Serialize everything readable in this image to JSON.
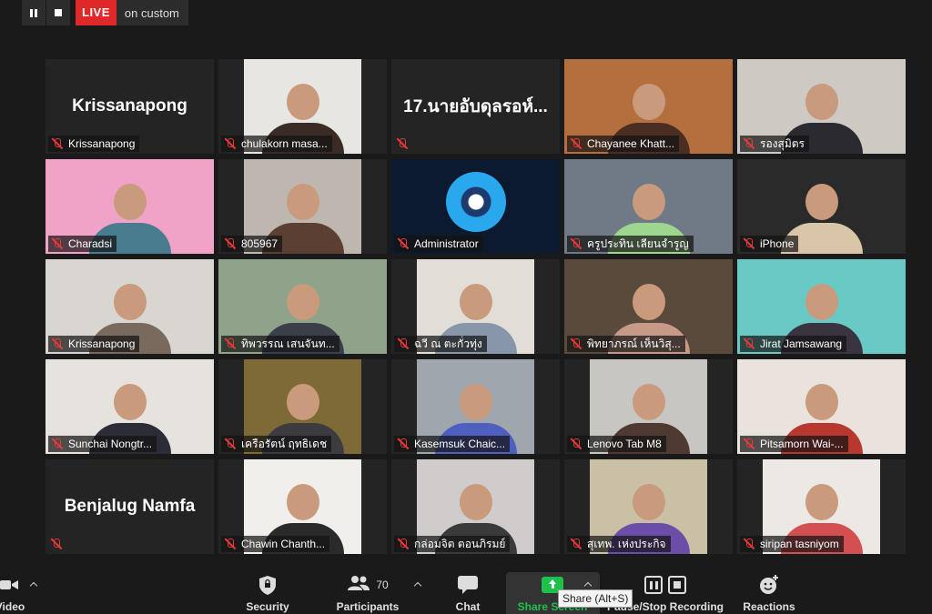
{
  "topbar": {
    "live_label": "LIVE",
    "live_status": "on custom"
  },
  "tiles": [
    {
      "name": "Krissanapong",
      "big_name": "Krissanapong",
      "kind": "text"
    },
    {
      "name": "chulakorn masa...",
      "kind": "video",
      "bg": "#e8e6e2",
      "subject": "#3a2c24"
    },
    {
      "name": "",
      "big_name": "17.นายอับดุลรอห์...",
      "kind": "text"
    },
    {
      "name": "Chayanee Khatt...",
      "kind": "video",
      "bg": "#b56f3f",
      "subject": "#4b2e22"
    },
    {
      "name": "รองสุมิตร",
      "kind": "video",
      "bg": "#cfc9c3",
      "subject": "#2a2a30"
    },
    {
      "name": "Charadsi",
      "kind": "video",
      "bg": "#f0a3c6",
      "subject": "#4a7c8f"
    },
    {
      "name": "805967",
      "kind": "video",
      "bg": "#bdb7b0",
      "subject": "#5c3f33"
    },
    {
      "name": "Administrator",
      "kind": "video",
      "bg": "#0b1a2e",
      "subject": "#1c8fd4"
    },
    {
      "name": "ครูประทิน  เลียนจำรูญ",
      "kind": "video",
      "bg": "#6f7a86",
      "subject": "#9fd68f",
      "active": true
    },
    {
      "name": "iPhone",
      "kind": "video",
      "bg": "#2a2a2a",
      "subject": "#d9c6a8"
    },
    {
      "name": "Krissanapong",
      "kind": "video",
      "bg": "#d9d6d2",
      "subject": "#7a6a5e"
    },
    {
      "name": "ทิพวรรณ เสนจันท...",
      "kind": "video",
      "bg": "#8fa38a",
      "subject": "#3a3f4a"
    },
    {
      "name": "ฉวี ณ ตะกั่วทุ่ง",
      "kind": "video",
      "bg": "#e2ddd7",
      "subject": "#8796a8"
    },
    {
      "name": "พิทยาภรณ์ เห็นวิสุ...",
      "kind": "video",
      "bg": "#5a4a3c",
      "subject": "#c79a88"
    },
    {
      "name": "Jirat Jamsawang",
      "kind": "video",
      "bg": "#69c9c4",
      "subject": "#3a3440"
    },
    {
      "name": "Sunchai Nongtr...",
      "kind": "video",
      "bg": "#e6e3df",
      "subject": "#2c2c36"
    },
    {
      "name": "เครือรัตน์  ฤทธิเดช",
      "kind": "video",
      "bg": "#7d6a36",
      "subject": "#3c3c40"
    },
    {
      "name": "Kasemsuk Chaic...",
      "kind": "video",
      "bg": "#9fa6ad",
      "subject": "#4f5fc0"
    },
    {
      "name": "Lenovo Tab M8",
      "kind": "video",
      "bg": "#c8c6c2",
      "subject": "#4e3a30"
    },
    {
      "name": "Pitsamorn Wai-...",
      "kind": "video",
      "bg": "#e9e2dd",
      "subject": "#b83830"
    },
    {
      "name": "",
      "big_name": "Benjalug Namfa",
      "kind": "text"
    },
    {
      "name": "Chawin Chanth...",
      "kind": "video",
      "bg": "#f1efec",
      "subject": "#2a2a2a"
    },
    {
      "name": "กล่อมจิต ตอนภิรมย์",
      "kind": "video",
      "bg": "#cfcccb",
      "subject": "#3a3a3a"
    },
    {
      "name": "สุเทพ. เห่งประกิจ",
      "kind": "video",
      "bg": "#c9c0a6",
      "subject": "#6c4ea8"
    },
    {
      "name": "siripan tasniyom",
      "kind": "video",
      "bg": "#ece9e4",
      "subject": "#d45050"
    }
  ],
  "toolbar": {
    "video_label": "Video",
    "security_label": "Security",
    "participants_label": "Participants",
    "participants_count": "70",
    "chat_label": "Chat",
    "share_label": "Share Screen",
    "share_tooltip": "Share (Alt+S)",
    "record_label": "Pause/Stop Recording",
    "reactions_label": "Reactions"
  },
  "colors": {
    "live": "#e02828",
    "active_speaker": "#d8e848",
    "share": "#1ec14b",
    "muted": "#e63a3a"
  }
}
